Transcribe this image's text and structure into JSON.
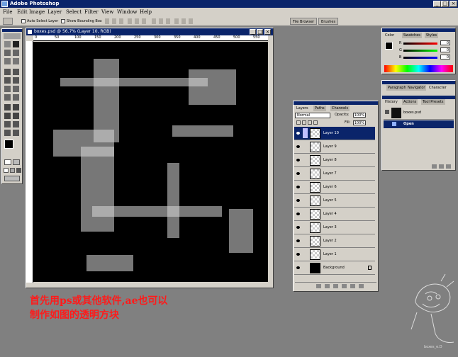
{
  "app": {
    "title": "Adobe Photoshop"
  },
  "menu": [
    "File",
    "Edit",
    "Image",
    "Layer",
    "Select",
    "Filter",
    "View",
    "Window",
    "Help"
  ],
  "options_bar": {
    "auto_select_label": "Auto Select Layer",
    "bounding_box_label": "Show Bounding Box",
    "right_tabs": [
      "File Browser",
      "Brushes"
    ]
  },
  "document": {
    "title": "boxes.psd @ 56.7% (Layer 10, RGB)",
    "ruler_ticks": [
      "0",
      "50",
      "100",
      "150",
      "200",
      "250",
      "300",
      "350",
      "400",
      "450",
      "500",
      "550"
    ]
  },
  "layers_panel": {
    "tabs": [
      "Layers",
      "Paths",
      "Channels"
    ],
    "blend_mode": "Normal",
    "opacity_label": "Opacity:",
    "opacity_value": "100%",
    "fill_label": "Fill:",
    "fill_value": "100%",
    "layers": [
      {
        "name": "Layer 10",
        "selected": true
      },
      {
        "name": "Layer 9",
        "selected": false
      },
      {
        "name": "Layer 8",
        "selected": false
      },
      {
        "name": "Layer 7",
        "selected": false
      },
      {
        "name": "Layer 6",
        "selected": false
      },
      {
        "name": "Layer 5",
        "selected": false
      },
      {
        "name": "Layer 4",
        "selected": false
      },
      {
        "name": "Layer 3",
        "selected": false
      },
      {
        "name": "Layer 2",
        "selected": false
      },
      {
        "name": "Layer 1",
        "selected": false
      },
      {
        "name": "Background",
        "selected": false
      }
    ]
  },
  "color_panel": {
    "tabs": [
      "Color",
      "Swatches",
      "Styles"
    ],
    "channels": [
      {
        "label": "R",
        "value": "0"
      },
      {
        "label": "G",
        "value": "0"
      },
      {
        "label": "B",
        "value": "0"
      }
    ]
  },
  "history_panel": {
    "top_tabs": [
      "Paragraph",
      "Navigator",
      "Character"
    ],
    "tabs": [
      "History",
      "Actions",
      "Tool Presets"
    ],
    "snapshot": "boxes.psd",
    "step": "Open"
  },
  "caption": {
    "line1": "首先用ps或其他软件,ae也可以",
    "line2": "制作如图的透明方块"
  },
  "signature_text": "boxes_e.D"
}
